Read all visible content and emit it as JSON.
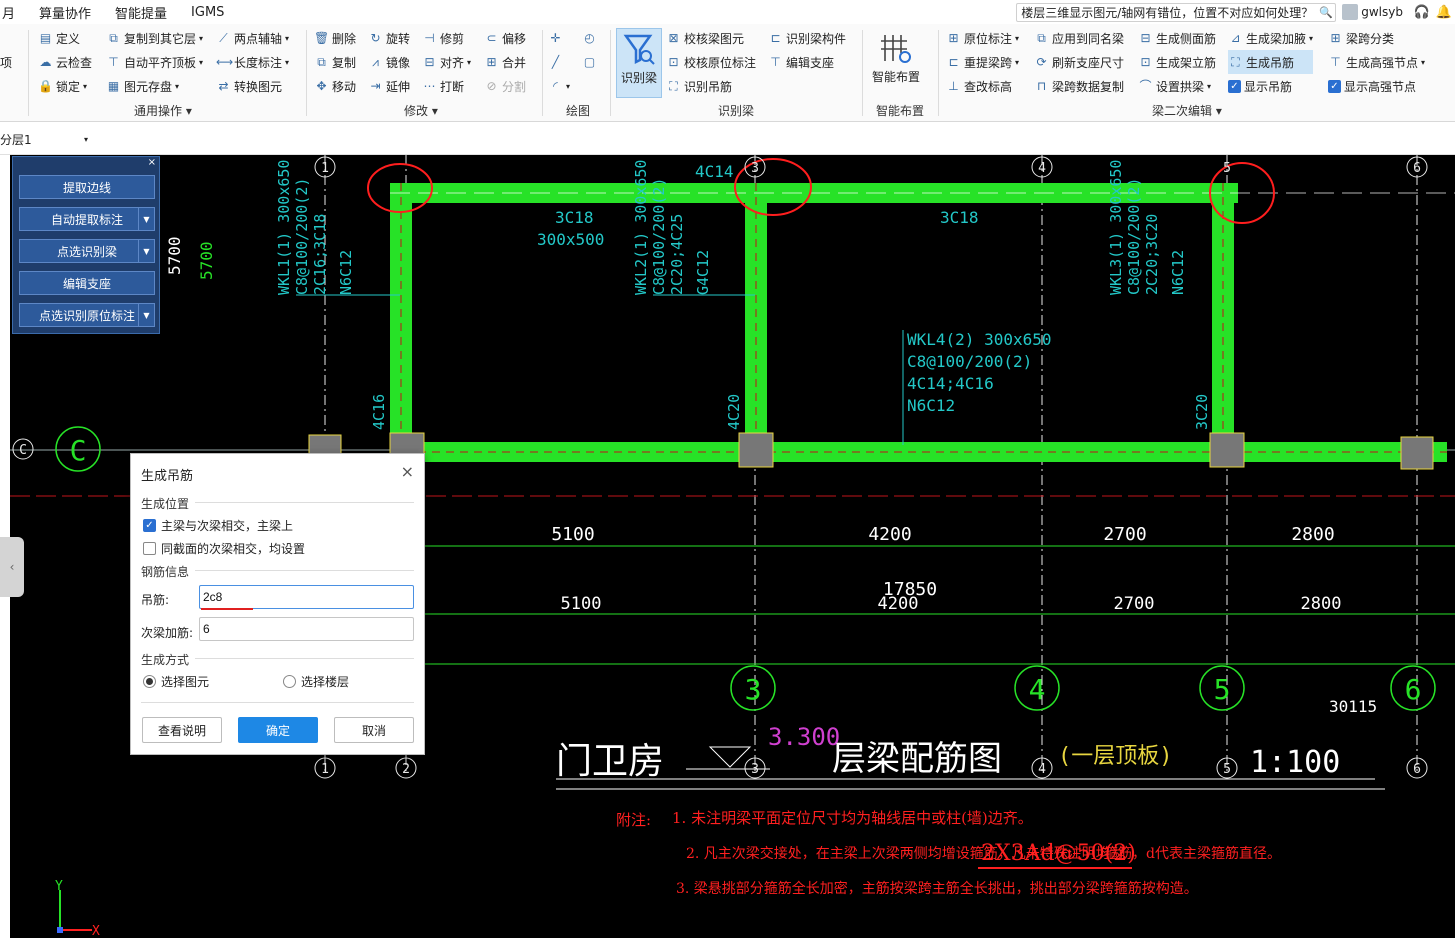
{
  "menubar": {
    "items": [
      "月",
      "算量协作",
      "智能提量",
      "IGMS"
    ],
    "search_text": "楼层三维显示图元/轴网有错位，位置不对应如何处理？",
    "username": "gwlsyb"
  },
  "ribbon": {
    "cut_label": "项",
    "general": {
      "col1": [
        "定义",
        "云检查",
        "锁定"
      ],
      "col2": [
        "复制到其它层",
        "自动平齐顶板",
        "图元存盘"
      ],
      "col3": [
        "两点辅轴",
        "长度标注",
        "转换图元"
      ],
      "label": "通用操作"
    },
    "modify": {
      "col1": [
        "删除",
        "复制",
        "移动"
      ],
      "col2": [
        "旋转",
        "镜像",
        "延伸"
      ],
      "col3": [
        "修剪",
        "对齐",
        "打断"
      ],
      "col4": [
        "偏移",
        "合并",
        "分割"
      ],
      "label": "修改"
    },
    "draw": {
      "label": "绘图"
    },
    "beam_id": {
      "big_label": "识别梁",
      "col1": [
        "校核梁图元",
        "校核原位标注",
        "识别吊筋"
      ],
      "col2": [
        "识别梁构件",
        "编辑支座"
      ],
      "label": "识别梁"
    },
    "smart": {
      "big_label": "智能布置",
      "label": "智能布置"
    },
    "secondary": {
      "col1": [
        "原位标注",
        "重提梁跨",
        "查改标高"
      ],
      "col2": [
        "应用到同名梁",
        "刷新支座尺寸",
        "梁跨数据复制"
      ],
      "col3": [
        "生成侧面筋",
        "生成架立筋",
        "设置拱梁"
      ],
      "col4": [
        "生成梁加腋",
        "生成吊筋",
        "显示吊筋"
      ],
      "col5": [
        "梁跨分类",
        "生成高强节点",
        "显示高强节点"
      ],
      "label": "梁二次编辑"
    }
  },
  "floor": {
    "value": "分层1"
  },
  "panel": {
    "buttons": [
      "提取边线",
      "自动提取标注",
      "点选识别梁",
      "编辑支座",
      "点选识别原位标注"
    ]
  },
  "dialog": {
    "title": "生成吊筋",
    "section_position": "生成位置",
    "opt_main_secondary": "主梁与次梁相交，主梁上",
    "opt_same_section": "同截面的次梁相交，均设置",
    "section_rebar": "钢筋信息",
    "hanger_label": "吊筋:",
    "hanger_value": "2c8",
    "extra_label": "次梁加筋:",
    "extra_value": "6",
    "section_method": "生成方式",
    "radio_select_elem": "选择图元",
    "radio_select_floor": "选择楼层",
    "btn_help": "查看说明",
    "btn_ok": "确定",
    "btn_cancel": "取消"
  },
  "drawing": {
    "axis_top": [
      "1",
      "3",
      "4",
      "5",
      "6"
    ],
    "axis_bottom": [
      "1",
      "2",
      "3",
      "4",
      "5",
      "6"
    ],
    "axis_big": [
      "3",
      "4",
      "5",
      "6"
    ],
    "axis_c": "C",
    "dim_5700": "5700",
    "dims_row1": [
      "5100",
      "4200",
      "2700",
      "2800"
    ],
    "dims_row2": [
      "5100",
      "4200",
      "2700",
      "2800"
    ],
    "total": "17850",
    "beam_4c14": "4C14",
    "beam_3c18_a": "3C18",
    "beam_300x500": "300x500",
    "beam_3c18_b": "3C18",
    "wkl1": [
      "WKL1(1) 300x650",
      "C8@100/200(2)",
      "2C16;3C18",
      "N6C12"
    ],
    "wkl2": [
      "WKL2(1) 300x650",
      "C8@100/200(2)",
      "2C20;4C25",
      "G4C12"
    ],
    "wkl3": [
      "WKL3(1) 300x650",
      "C8@100/200(2)",
      "2C20;3C20",
      "N6C12"
    ],
    "wkl4": [
      "WKL4(2) 300x650",
      "C8@100/200(2)",
      "4C14;4C16",
      "N6C12"
    ],
    "side_4c16": "4C16",
    "side_4c20": "4C20",
    "side_3c20": "3C20",
    "num_30115": "30115",
    "title_main": "门卫房",
    "elev": "3.300",
    "title_sub": "层梁配筋图",
    "title_paren": "(一层顶板)",
    "scale": "1:100",
    "notes_head": "附注:",
    "note1": "1.  未注明梁平面定位尺寸均为轴线居中或柱(墙)边齐。",
    "note2a": "2.  凡主次梁交接处，在主梁上次梁两侧均增设箍筋，凡未特殊注明均为",
    "note2b": "2X3Ad@50(2)",
    "note2c": "箍筋，d代表主梁箍筋直径。",
    "note3": "3.  梁悬挑部分箍筋全长加密，主筋按梁跨主筋全长挑出，挑出部分梁跨箍筋按构造。",
    "ucs_y": "Y",
    "ucs_x": "X"
  }
}
